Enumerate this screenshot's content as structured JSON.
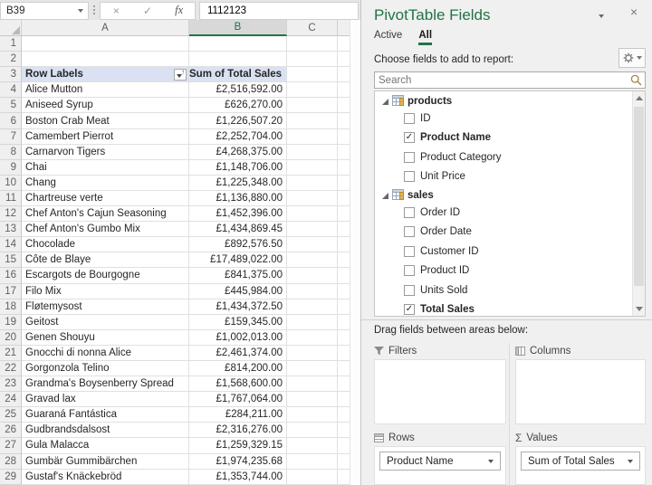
{
  "formula_bar": {
    "cell_reference": "B39",
    "formula_value": "1112123",
    "cancel_glyph": "×",
    "check_glyph": "✓",
    "fx_label": "fx"
  },
  "sheet": {
    "columns": [
      "A",
      "B",
      "C"
    ],
    "selected_column": "B",
    "first_row": 1,
    "last_row": 29,
    "pivot_header_row": 3,
    "pivot_header": {
      "row_labels": "Row Labels",
      "value_header": "Sum of Total Sales",
      "sort_arrow_glyph": "↑"
    },
    "data_start_row": 4,
    "rows": [
      {
        "product": "Alice Mutton",
        "value": "£2,516,592.00"
      },
      {
        "product": "Aniseed Syrup",
        "value": "£626,270.00"
      },
      {
        "product": "Boston Crab Meat",
        "value": "£1,226,507.20"
      },
      {
        "product": "Camembert Pierrot",
        "value": "£2,252,704.00"
      },
      {
        "product": "Carnarvon Tigers",
        "value": "£4,268,375.00"
      },
      {
        "product": "Chai",
        "value": "£1,148,706.00"
      },
      {
        "product": "Chang",
        "value": "£1,225,348.00"
      },
      {
        "product": "Chartreuse verte",
        "value": "£1,136,880.00"
      },
      {
        "product": "Chef Anton's Cajun Seasoning",
        "value": "£1,452,396.00"
      },
      {
        "product": "Chef Anton's Gumbo Mix",
        "value": "£1,434,869.45"
      },
      {
        "product": "Chocolade",
        "value": "£892,576.50"
      },
      {
        "product": "Côte de Blaye",
        "value": "£17,489,022.00"
      },
      {
        "product": "Escargots de Bourgogne",
        "value": "£841,375.00"
      },
      {
        "product": "Filo Mix",
        "value": "£445,984.00"
      },
      {
        "product": "Fløtemysost",
        "value": "£1,434,372.50"
      },
      {
        "product": "Geitost",
        "value": "£159,345.00"
      },
      {
        "product": "Genen Shouyu",
        "value": "£1,002,013.00"
      },
      {
        "product": "Gnocchi di nonna Alice",
        "value": "£2,461,374.00"
      },
      {
        "product": "Gorgonzola Telino",
        "value": "£814,200.00"
      },
      {
        "product": "Grandma's Boysenberry Spread",
        "value": "£1,568,600.00"
      },
      {
        "product": "Gravad lax",
        "value": "£1,767,064.00"
      },
      {
        "product": "Guaraná Fantástica",
        "value": "£284,211.00"
      },
      {
        "product": "Gudbrandsdalsost",
        "value": "£2,316,276.00"
      },
      {
        "product": "Gula Malacca",
        "value": "£1,259,329.15"
      },
      {
        "product": "Gumbär Gummibärchen",
        "value": "£1,974,235.68"
      },
      {
        "product": "Gustaf's Knäckebröd",
        "value": "£1,353,744.00"
      }
    ]
  },
  "panel": {
    "title": "PivotTable Fields",
    "close_glyph": "×",
    "tabs": [
      {
        "label": "Active",
        "active": false
      },
      {
        "label": "All",
        "active": true
      }
    ],
    "choose_label": "Choose fields to add to report:",
    "search_placeholder": "Search",
    "groups": [
      {
        "name": "products",
        "fields": [
          {
            "label": "ID",
            "checked": false
          },
          {
            "label": "Product Name",
            "checked": true
          },
          {
            "label": "Product Category",
            "checked": false
          },
          {
            "label": "Unit Price",
            "checked": false
          }
        ]
      },
      {
        "name": "sales",
        "fields": [
          {
            "label": "Order ID",
            "checked": false
          },
          {
            "label": "Order Date",
            "checked": false
          },
          {
            "label": "Customer ID",
            "checked": false
          },
          {
            "label": "Product ID",
            "checked": false
          },
          {
            "label": "Units Sold",
            "checked": false
          },
          {
            "label": "Total Sales",
            "checked": true
          }
        ]
      }
    ],
    "check_glyph": "✓",
    "drag_label": "Drag fields between areas below:",
    "areas": {
      "filters": {
        "label": "Filters",
        "items": []
      },
      "columns": {
        "label": "Columns",
        "items": []
      },
      "rows": {
        "label": "Rows",
        "items": [
          "Product Name"
        ]
      },
      "values": {
        "label": "Values",
        "items": [
          "Sum of Total Sales"
        ],
        "sigma_glyph": "Σ"
      }
    }
  },
  "colors": {
    "excel_green": "#217346",
    "pivot_header_blue": "#D9E1F2",
    "selected_column_header": "#D8D8D8",
    "pane_background": "#F0F0F0",
    "search_icon_gold": "#A3874C"
  }
}
